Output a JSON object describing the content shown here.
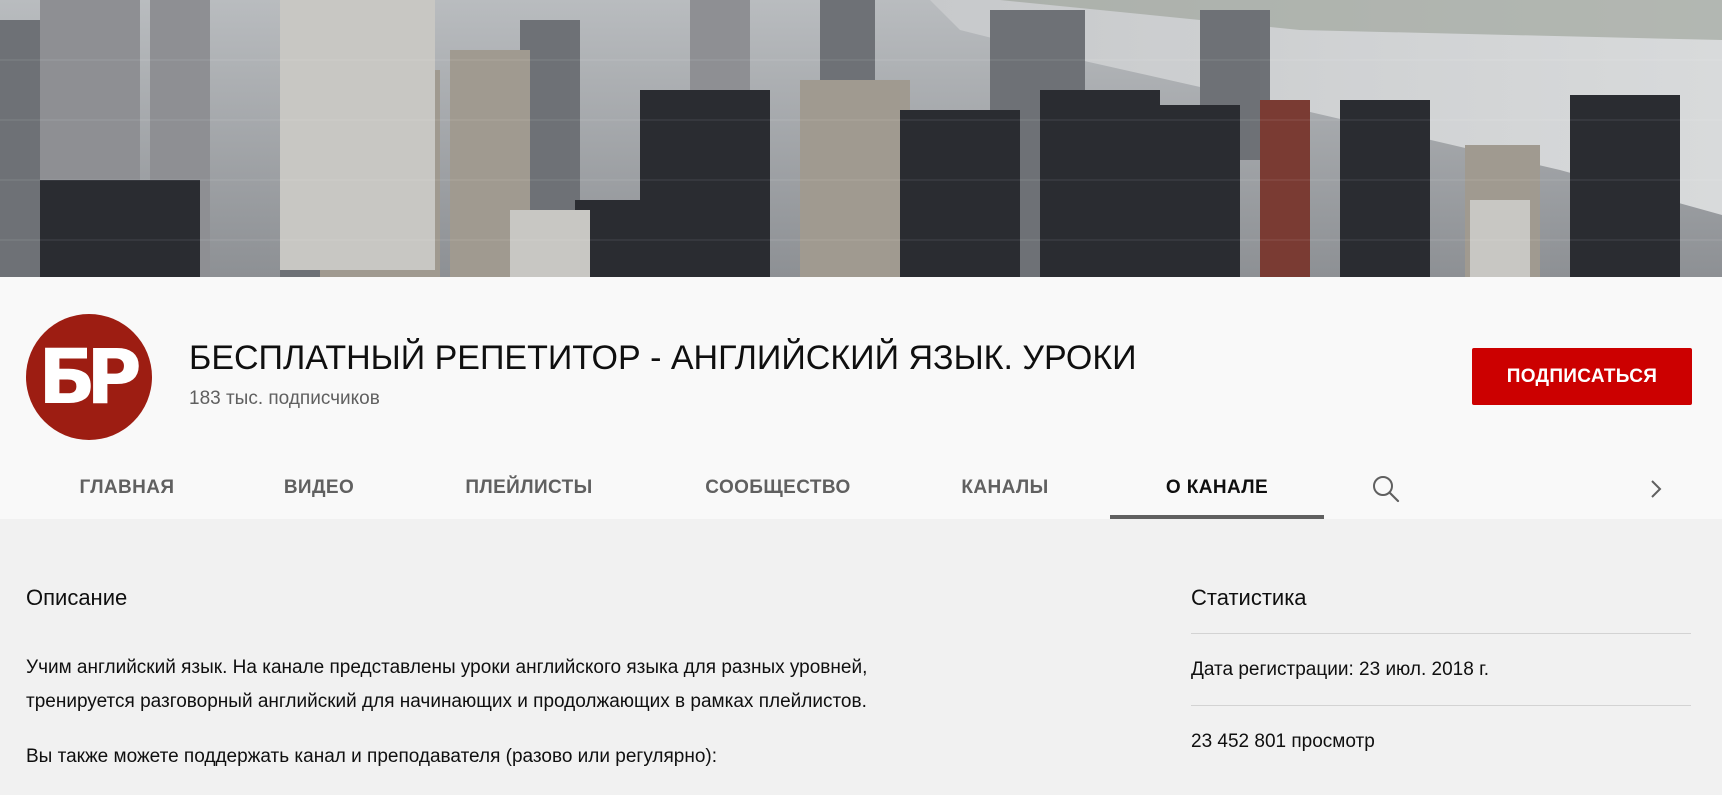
{
  "channel": {
    "avatar_text": "БР",
    "name": "БЕСПЛАТНЫЙ РЕПЕТИТОР - АНГЛИЙСКИЙ ЯЗЫК. УРОКИ",
    "subscribers": "183 тыс. подписчиков",
    "subscribe_label": "ПОДПИСАТЬСЯ"
  },
  "tabs": [
    {
      "label": "ГЛАВНАЯ"
    },
    {
      "label": "ВИДЕО"
    },
    {
      "label": "ПЛЕЙЛИСТЫ"
    },
    {
      "label": "СООБЩЕСТВО"
    },
    {
      "label": "КАНАЛЫ"
    },
    {
      "label": "О КАНАЛЕ",
      "active": true
    }
  ],
  "icons": {
    "search": "search-icon",
    "next": "chevron-right-icon"
  },
  "about": {
    "description_title": "Описание",
    "description_lines": [
      "Учим английский язык. На канале представлены уроки английского языка для разных уровней,",
      "тренируется разговорный английский для начинающих и продолжающих в рамках плейлистов.",
      "Вы также можете поддержать канал и преподавателя (разово или регулярно):"
    ],
    "stats_title": "Статистика",
    "registration": "Дата регистрации: 23 июл. 2018 г.",
    "views": "23 452 801 просмотр"
  },
  "colors": {
    "subscribe_bg": "#cc0000",
    "avatar_bg": "#9d1d12",
    "page_bg": "#f1f1f1",
    "header_bg": "#f9f9f9"
  }
}
